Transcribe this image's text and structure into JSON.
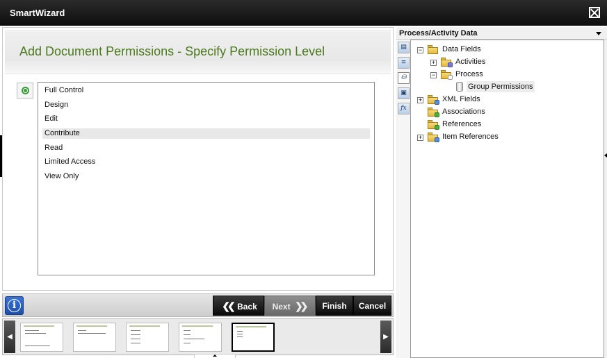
{
  "window": {
    "title": "SmartWizard"
  },
  "main": {
    "page_title": "Add Document Permissions - Specify Permission Level",
    "permissions": [
      "Full Control",
      "Design",
      "Edit",
      "Contribute",
      "Read",
      "Limited Access",
      "View Only"
    ],
    "selected_permission": "Contribute"
  },
  "actions": {
    "back": "Back",
    "next": "Next",
    "finish": "Finish",
    "cancel": "Cancel"
  },
  "thumbnails": {
    "count": 5,
    "current_index": 4
  },
  "panel": {
    "title": "Process/Activity Data",
    "tabs": [
      "process-data-icon",
      "notes-icon",
      "context-browser-icon",
      "form-icon",
      "function-icon"
    ],
    "active_tab_index": 2,
    "tree": {
      "data_fields": "Data Fields",
      "activities": "Activities",
      "process": "Process",
      "group_permissions": "Group Permissions",
      "xml_fields": "XML Fields",
      "associations": "Associations",
      "references": "References",
      "item_references": "Item References"
    }
  },
  "colors": {
    "title_green": "#4a7a1c",
    "titlebar": "#111111",
    "button_dark": "#1a1a1a",
    "info_blue": "#2a60c0"
  }
}
